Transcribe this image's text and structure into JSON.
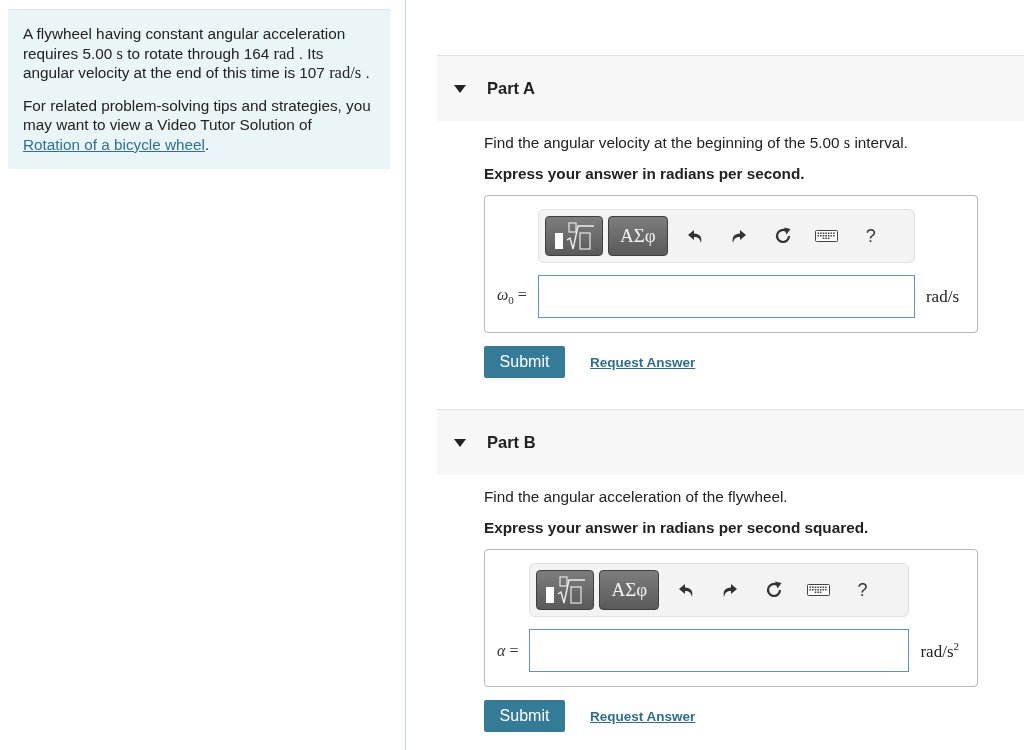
{
  "intro": {
    "statement": [
      {
        "kind": "text",
        "text": "A flywheel having constant angular acceleration requires 5.00 "
      },
      {
        "kind": "math",
        "text": "s"
      },
      {
        "kind": "text",
        "text": " to rotate through 164 "
      },
      {
        "kind": "math",
        "text": "rad"
      },
      {
        "kind": "text",
        "text": " . Its angular velocity at the end of this time is 107 "
      },
      {
        "kind": "math",
        "text": "rad/s"
      },
      {
        "kind": "text",
        "text": " ."
      }
    ],
    "tips": {
      "text": "For related problem-solving tips and strategies, you may want to view a Video Tutor Solution of ",
      "link": "Rotation of a bicycle wheel",
      "end": "."
    }
  },
  "parts": [
    {
      "title": "Part A",
      "expanded": true,
      "question": [
        {
          "kind": "text",
          "text": "Find the angular velocity at the beginning of the 5.00 "
        },
        {
          "kind": "math",
          "text": "s"
        },
        {
          "kind": "text",
          "text": " interval."
        }
      ],
      "instruction": "Express your answer in radians per second.",
      "toolbar": {
        "symbols": "ΑΣφ",
        "help": "?"
      },
      "variable": "*ω*$_{0}$ =",
      "unit": "rad/s",
      "submit": "Submit",
      "request": "Request Answer"
    },
    {
      "title": "Part B",
      "expanded": true,
      "question": [
        {
          "kind": "text",
          "text": "Find the angular acceleration of the flywheel."
        }
      ],
      "instruction": "Express your answer in radians per second squared.",
      "toolbar": {
        "symbols": "ΑΣφ",
        "help": "?"
      },
      "variable": "*α* =",
      "unit": "rad/s$^{2}$",
      "submit": "Submit",
      "request": "Request Answer"
    }
  ]
}
